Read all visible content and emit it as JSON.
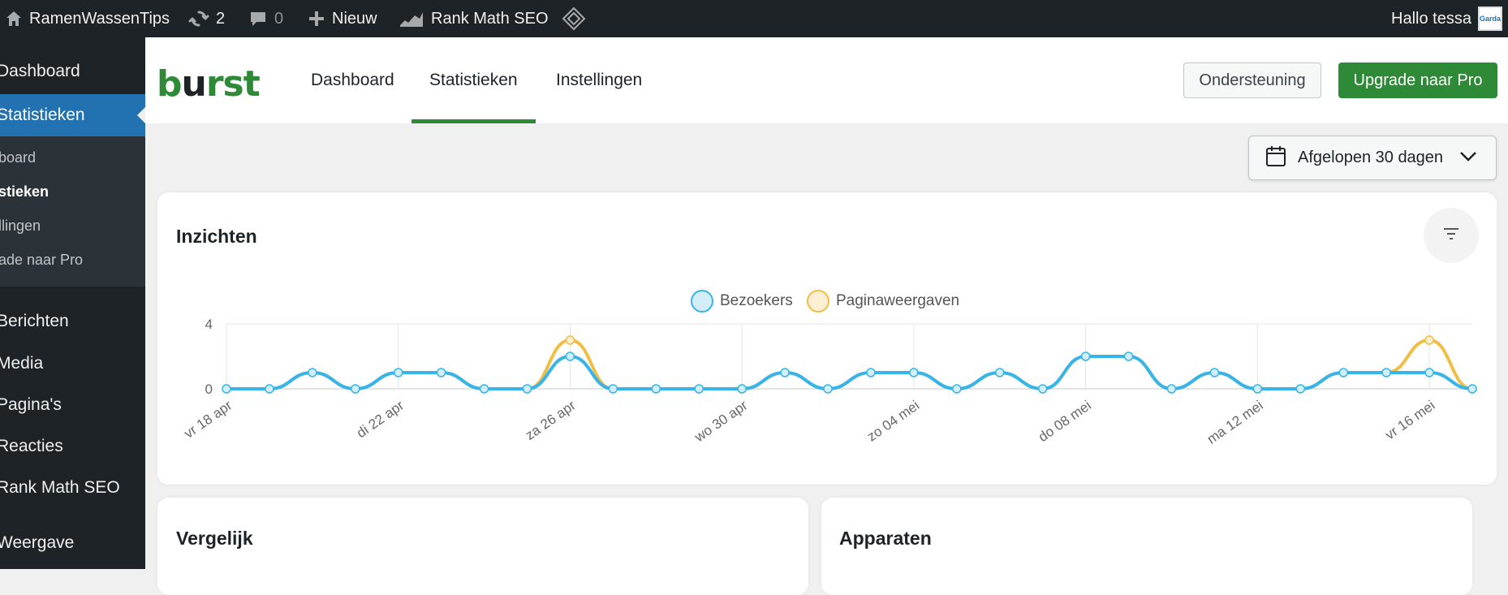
{
  "adminbar": {
    "site_name": "RamenWassenTips",
    "updates_count": "2",
    "comments_count": "0",
    "new_label": "Nieuw",
    "rankmath_label": "Rank Math SEO",
    "greeting": "Hallo tessa",
    "avatar_text": "Garda",
    "icons": [
      "home-icon",
      "updates-icon",
      "comments-icon",
      "plus-icon",
      "rankmath-icon",
      "diamond-icon"
    ]
  },
  "sidebar": {
    "items": [
      {
        "label": "Dashboard"
      },
      {
        "label": "Statistieken"
      },
      {
        "label": "Berichten"
      },
      {
        "label": "Media"
      },
      {
        "label": "Pagina's"
      },
      {
        "label": "Reacties"
      },
      {
        "label": "Rank Math SEO"
      },
      {
        "label": "Weergave"
      }
    ],
    "submenu": [
      {
        "label": "board"
      },
      {
        "label": "stieken"
      },
      {
        "label": "llingen"
      },
      {
        "label": "ade naar Pro"
      }
    ]
  },
  "topnav": {
    "logo": {
      "prefix": "b",
      "u": "u",
      "suffix": "rst"
    },
    "tabs": [
      {
        "label": "Dashboard"
      },
      {
        "label": "Statistieken"
      },
      {
        "label": "Instellingen"
      }
    ],
    "support_label": "Ondersteuning",
    "pro_label": "Upgrade naar Pro"
  },
  "date_picker": {
    "label": "Afgelopen 30 dagen"
  },
  "insights": {
    "title": "Inzichten"
  },
  "compare": {
    "title": "Vergelijk"
  },
  "devices": {
    "title": "Apparaten"
  },
  "colors": {
    "accent": "#2e8a37",
    "wp_blue": "#2271b1",
    "visitors": "#36b5eb",
    "pageviews": "#f2bd43"
  },
  "chart_data": {
    "type": "line",
    "x": [
      "vr 18 apr",
      "za 19 apr",
      "zo 20 apr",
      "ma 21 apr",
      "di 22 apr",
      "wo 23 apr",
      "do 24 apr",
      "vr 25 apr",
      "za 26 apr",
      "zo 27 apr",
      "ma 28 apr",
      "di 29 apr",
      "wo 30 apr",
      "do 01 mei",
      "vr 02 mei",
      "za 03 mei",
      "zo 04 mei",
      "ma 05 mei",
      "di 06 mei",
      "wo 07 mei",
      "do 08 mei",
      "vr 09 mei",
      "za 10 mei",
      "zo 11 mei",
      "ma 12 mei",
      "di 13 mei",
      "wo 14 mei",
      "do 15 mei",
      "vr 16 mei",
      "za 17 mei"
    ],
    "tick_labels": [
      "vr 18 apr",
      "di 22 apr",
      "za 26 apr",
      "wo 30 apr",
      "zo 04 mei",
      "do 08 mei",
      "ma 12 mei",
      "vr 16 mei"
    ],
    "series": [
      {
        "name": "Bezoekers",
        "values": [
          0,
          0,
          1,
          0,
          1,
          1,
          0,
          0,
          2,
          0,
          0,
          0,
          0,
          1,
          0,
          1,
          1,
          0,
          1,
          0,
          2,
          2,
          0,
          1,
          0,
          0,
          1,
          1,
          1,
          0
        ]
      },
      {
        "name": "Paginaweergaven",
        "values": [
          0,
          0,
          1,
          0,
          1,
          1,
          0,
          0,
          3,
          0,
          0,
          0,
          0,
          1,
          0,
          1,
          1,
          0,
          1,
          0,
          2,
          2,
          0,
          1,
          0,
          0,
          1,
          1,
          3,
          0
        ]
      }
    ],
    "y_ticks": [
      "0",
      "4"
    ],
    "ylim": [
      0,
      4
    ],
    "legend": "top-center",
    "grid": true
  }
}
